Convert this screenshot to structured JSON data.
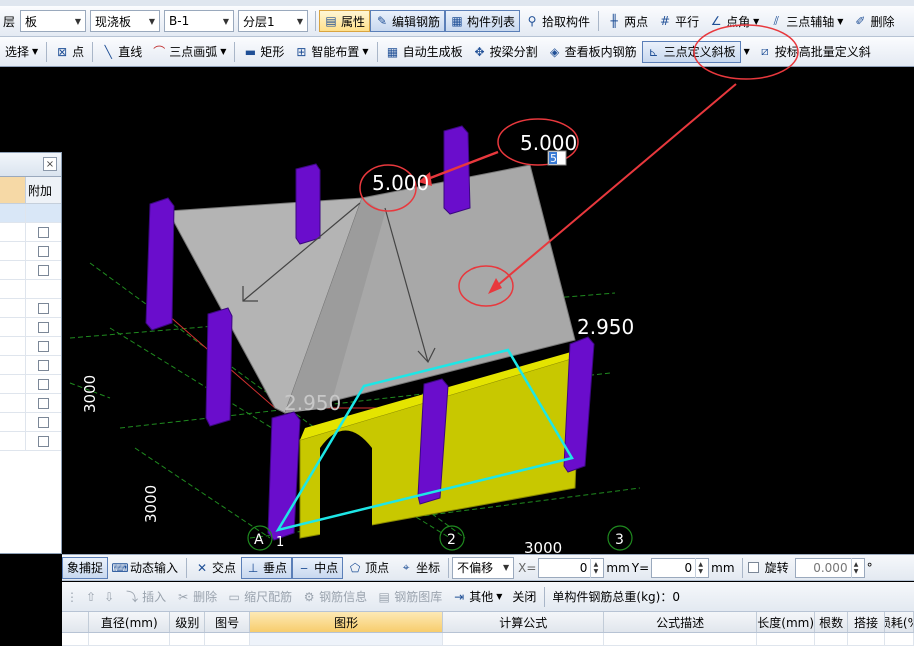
{
  "toolbar1": {
    "layer_label": "层",
    "category_combo": "板",
    "type_combo": "现浇板",
    "name_combo": "B-1",
    "floor_combo": "分层1",
    "properties_btn": "属性",
    "edit_rebar_btn": "编辑钢筋",
    "component_list_btn": "构件列表",
    "pick_component_btn": "拾取构件",
    "two_point_btn": "两点",
    "parallel_btn": "平行",
    "point_angle_btn": "点角",
    "three_point_axis_btn": "三点辅轴",
    "delete_btn": "删除"
  },
  "toolbar2": {
    "select_btn": "选择",
    "point_btn": "点",
    "line_btn": "直线",
    "arc_btn": "三点画弧",
    "rect_btn": "矩形",
    "smart_layout_btn": "智能布置",
    "auto_slab_btn": "自动生成板",
    "split_by_beam_btn": "按梁分割",
    "view_slab_rebar_btn": "查看板内钢筋",
    "three_point_slope_btn": "三点定义斜板",
    "batch_slope_btn": "按标高批量定义斜"
  },
  "viewport": {
    "elev_top_left": "5.000",
    "elev_top_right": "5.000",
    "elev_input": "5",
    "elev_bottom_left": "2.950",
    "elev_bottom_right": "2.950",
    "dim_left_upper": "3000",
    "dim_left_lower": "3000",
    "dim_bottom": "3000",
    "axis_a": "A",
    "axis_1": "1",
    "axis_2": "2",
    "axis_3": "3"
  },
  "floatpanel": {
    "close_glyph": "×",
    "col_extra": "附加",
    "rows": 13
  },
  "snapbar": {
    "object_snap": "象捕捉",
    "dynamic_input": "动态输入",
    "intersection": "交点",
    "perpendicular": "垂点",
    "midpoint": "中点",
    "vertex": "顶点",
    "coordinate": "坐标",
    "offset_combo": "不偏移",
    "x_label": "X=",
    "x_value": "0",
    "mm1": "mm",
    "y_label": "Y=",
    "y_value": "0",
    "mm2": "mm",
    "rotate_label": "旋转",
    "rotate_value": "0.000",
    "degree": "°"
  },
  "rebarbar": {
    "insert": "插入",
    "delete": "删除",
    "scale_rebar": "缩尺配筋",
    "rebar_info": "钢筋信息",
    "rebar_library": "钢筋图库",
    "other": "其他",
    "close": "关闭",
    "total_weight": "单构件钢筋总重(kg)：0"
  },
  "rebartable": {
    "headers": [
      "直径(mm)",
      "级别",
      "图号",
      "图形",
      "计算公式",
      "公式描述",
      "长度(mm)",
      "根数",
      "搭接",
      "损耗(%"
    ]
  },
  "colors": {
    "column": "#6a0dcc",
    "wall": "#c8c800",
    "roof": "#a9a9a9",
    "annotation": "#e8383d",
    "selection": "#1ee6e6",
    "grid": "#1f8a1f"
  }
}
